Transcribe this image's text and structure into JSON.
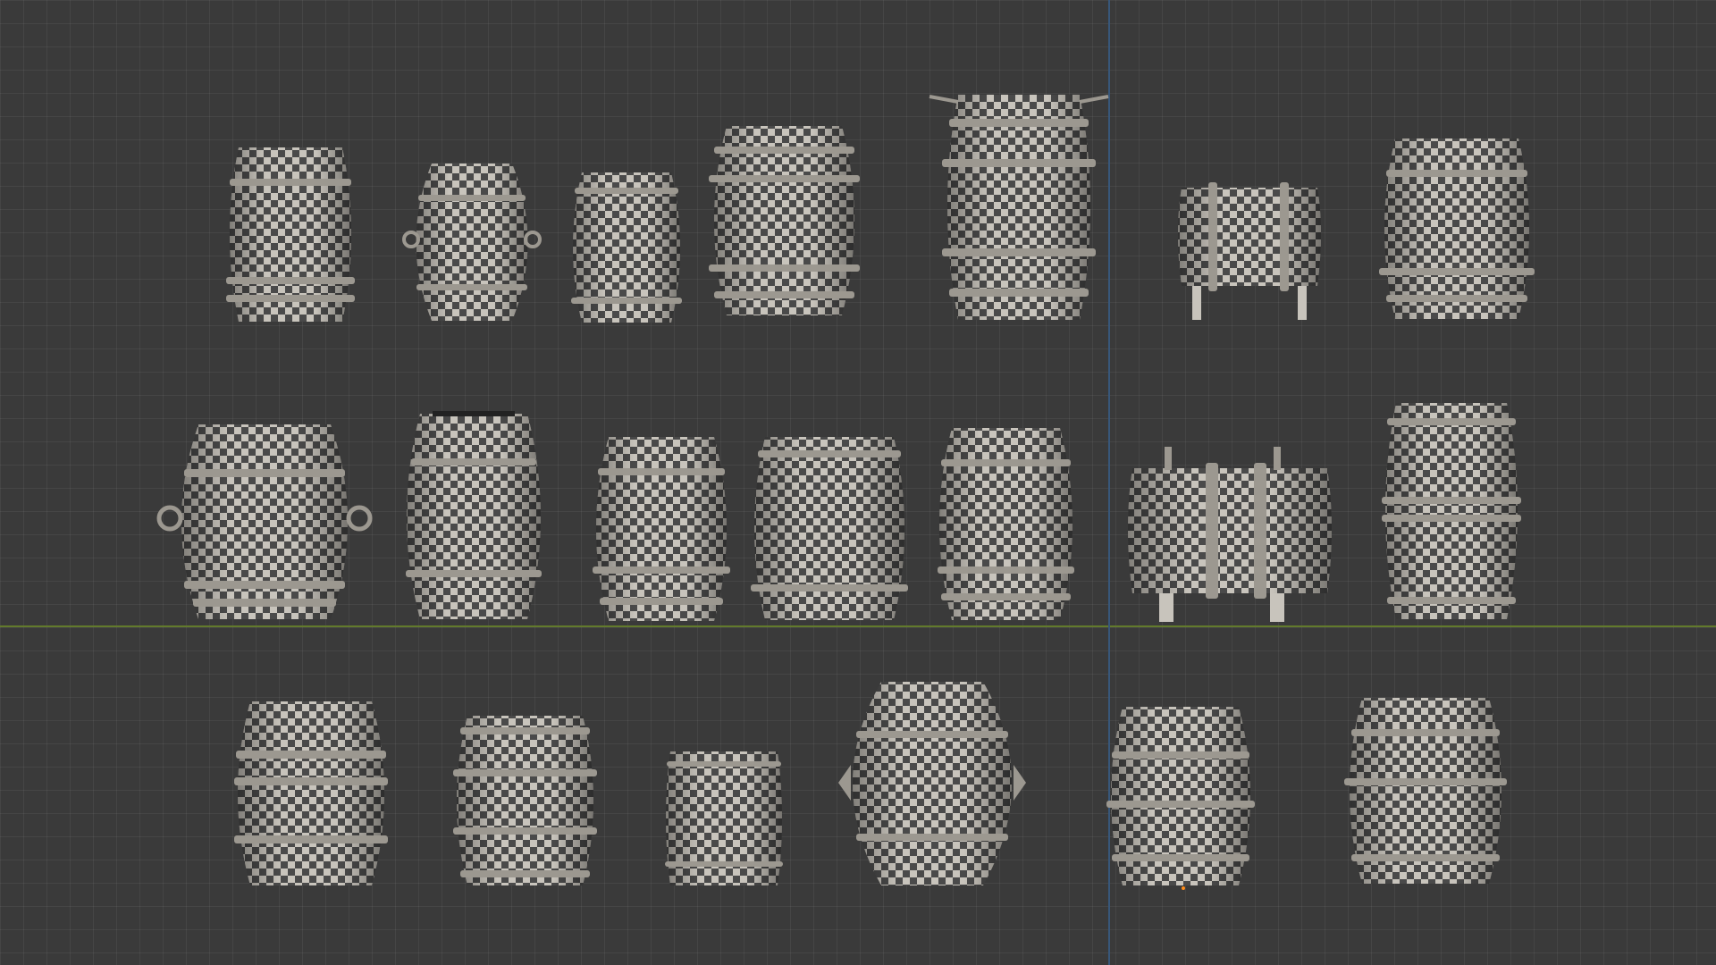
{
  "viewport": {
    "mode": "3D viewport",
    "shading": "uv-checker-texture",
    "colors": {
      "background": "#3a3a3a",
      "grid_line": "#454545",
      "x_axis": "#627a2c",
      "y_axis": "#38577a",
      "checker_light": "#c8c4bc",
      "checker_dark": "#4a4a4a",
      "origin_marker": "#ff8c1a"
    }
  },
  "rows": [
    {
      "name": "row-1",
      "barrel_count": 7
    },
    {
      "name": "row-2",
      "barrel_count": 7
    },
    {
      "name": "row-3",
      "barrel_count": 6
    }
  ],
  "barrel_total": 20
}
